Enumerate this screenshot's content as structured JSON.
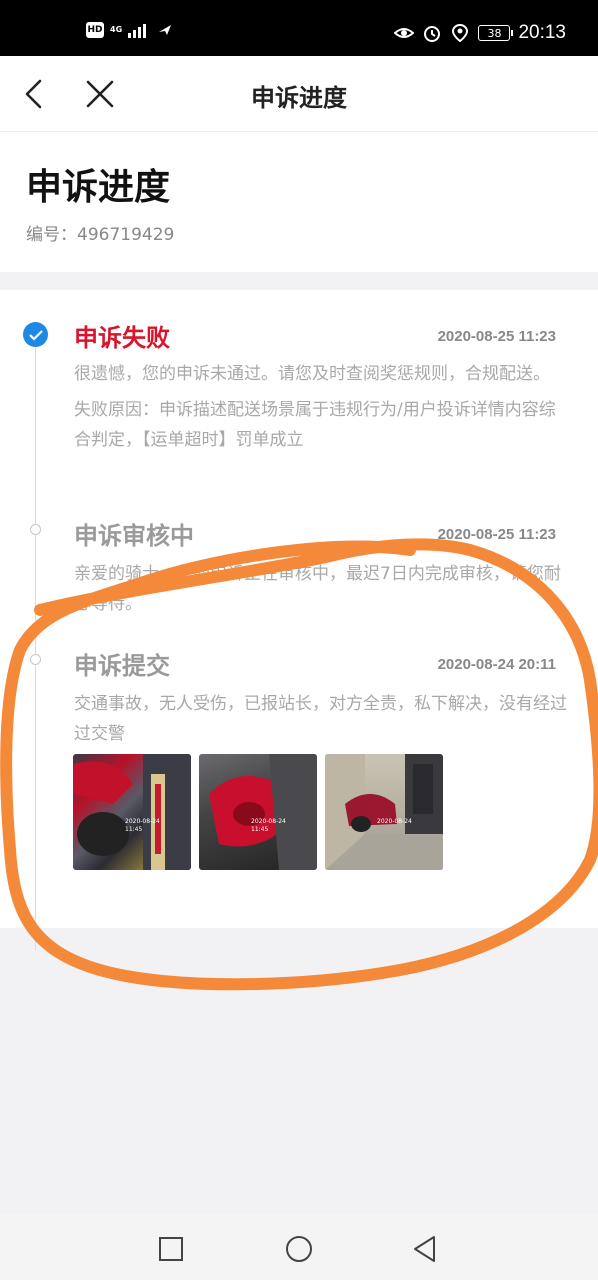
{
  "status_bar": {
    "hd": "HD",
    "network": "4G",
    "battery": "38",
    "time": "20:13",
    "icons": [
      "signal-icon",
      "wifi-icon",
      "eye-icon",
      "alarm-icon",
      "location-icon",
      "battery-icon"
    ]
  },
  "nav": {
    "title": "申诉进度",
    "back_icon": "chevron-left-icon",
    "close_icon": "close-icon"
  },
  "header": {
    "title": "申诉进度",
    "serial_label": "编号：",
    "serial_value": "496719429"
  },
  "timeline": {
    "items": [
      {
        "status": "申诉失败",
        "time": "2020-08-25 11:23",
        "text1": "很遗憾，您的申诉未通过。请您及时查阅奖惩规则，合规配送。",
        "text2": "失败原因：申诉描述配送场景属于违规行为/用户投诉详情内容综合判定，【运单超时】罚单成立"
      },
      {
        "status": "申诉审核中",
        "time": "2020-08-25 11:23",
        "text1": "亲爱的骑士，您的申诉正在审核中，最迟7日内完成审核，请您耐心等待。"
      },
      {
        "status": "申诉提交",
        "time": "2020-08-24 20:11",
        "text1": "交通事故，无人受伤，已报站长，对方全责，私下解决，没有经过过交警"
      }
    ],
    "photos": [
      {
        "stamp_date": "2020-08-24",
        "stamp_time": "11:45"
      },
      {
        "stamp_date": "2020-08-24",
        "stamp_time": "11:45"
      },
      {
        "stamp_date": "2020-08-24",
        "stamp_time": ""
      }
    ]
  },
  "colors": {
    "fail_red": "#d9142b",
    "check_blue": "#1e88e5",
    "annotation_orange": "#f5893a"
  },
  "system_nav": {
    "icons": [
      "recent-apps-icon",
      "home-icon",
      "back-triangle-icon"
    ]
  }
}
